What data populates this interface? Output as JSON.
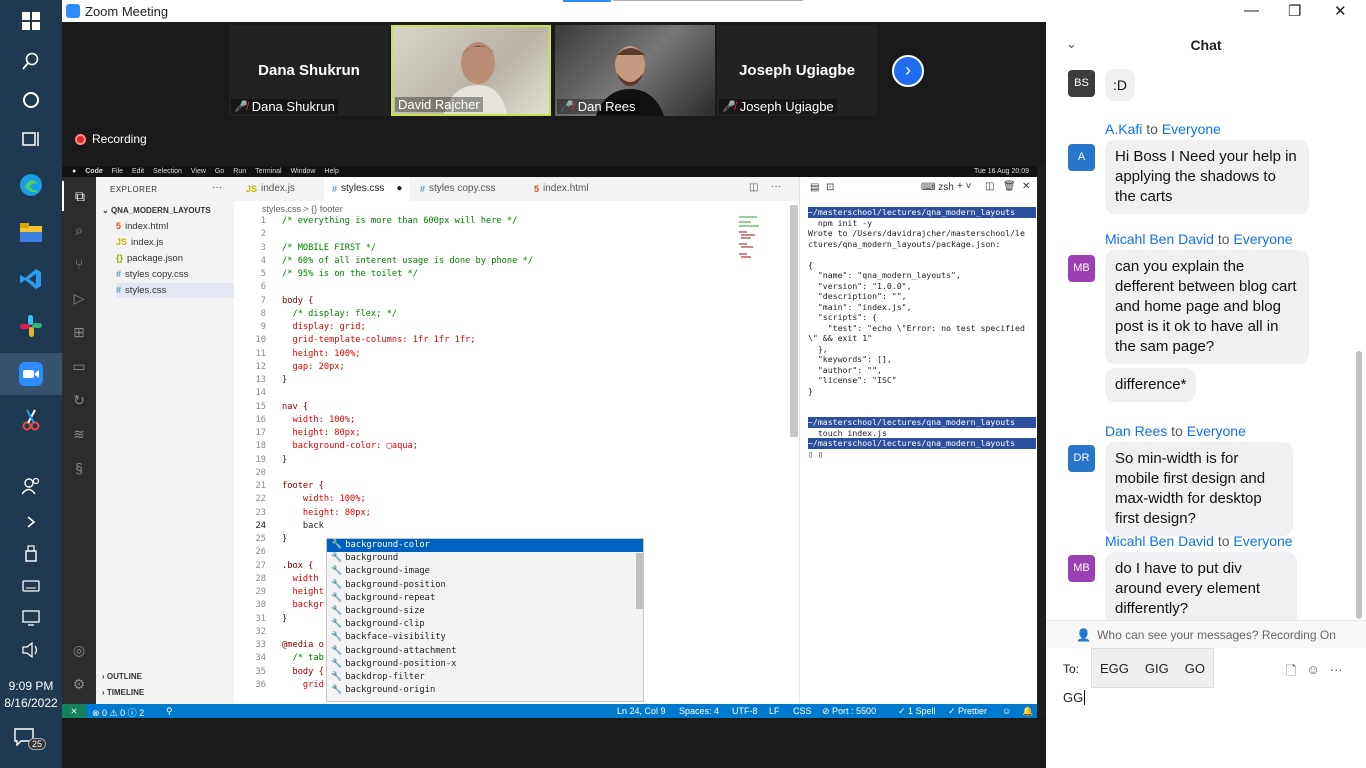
{
  "taskbar": {
    "icons": [
      "windows-icon",
      "search-icon",
      "cortana-icon",
      "task-view-icon",
      "edge-icon",
      "file-explorer-icon",
      "vscode-icon",
      "slack-icon",
      "zoom-icon",
      "snip-icon",
      "people-icon",
      "chevron-icon",
      "usb-icon",
      "keyboard-icon",
      "tablet-icon",
      "volume-icon"
    ],
    "time": "9:09 PM",
    "date": "8/16/2022",
    "notifications": "25"
  },
  "window": {
    "title": "Zoom Meeting",
    "controls": {
      "minimize": "—",
      "restore": "❐",
      "close": "✕"
    }
  },
  "gallery": {
    "participants": [
      {
        "name": "Dana Shukrun",
        "big_name": "Dana Shukrun",
        "muted": true,
        "video": false
      },
      {
        "name": "David Rajcher",
        "big_name": "",
        "muted": false,
        "video": true,
        "active": true
      },
      {
        "name": "Dan Rees",
        "big_name": "",
        "muted": true,
        "video": true
      },
      {
        "name": "Joseph Ugiagbe",
        "big_name": "Joseph Ugiagbe",
        "muted": true,
        "video": false
      }
    ],
    "next": "›",
    "recording": "Recording"
  },
  "mac_menu": {
    "items": [
      "Code",
      "File",
      "Edit",
      "Selection",
      "View",
      "Go",
      "Run",
      "Terminal",
      "Window",
      "Help"
    ],
    "clock": "Tue 16 Aug 20:09"
  },
  "vscode": {
    "explorer_title": "EXPLORER",
    "project": "QNA_MODERN_LAYOUTS",
    "files": [
      {
        "name": "index.html",
        "icon": "5",
        "color": "#e44d26"
      },
      {
        "name": "index.js",
        "icon": "JS",
        "color": "#cbb800"
      },
      {
        "name": "package.json",
        "icon": "{}",
        "color": "#8bb200"
      },
      {
        "name": "styles copy.css",
        "icon": "#",
        "color": "#519aba"
      },
      {
        "name": "styles.css",
        "icon": "#",
        "color": "#519aba",
        "selected": true
      }
    ],
    "outline": "OUTLINE",
    "timeline": "TIMELINE",
    "tabs": [
      {
        "label": "index.js",
        "icon": "JS",
        "color": "#cbb800"
      },
      {
        "label": "styles.css",
        "icon": "#",
        "color": "#519aba",
        "active": true,
        "modified": "●"
      },
      {
        "label": "styles copy.css",
        "icon": "#",
        "color": "#519aba"
      },
      {
        "label": "index.html",
        "icon": "5",
        "color": "#e44d26"
      }
    ],
    "breadcrumb": "styles.css > {} footer",
    "code_lines": [
      {
        "n": "1",
        "t": "/* everything is more than 600px will here */",
        "k": "cm"
      },
      {
        "n": "2",
        "t": "",
        "k": ""
      },
      {
        "n": "3",
        "t": "/* MOBILE FIRST */",
        "k": "cm"
      },
      {
        "n": "4",
        "t": "/* 60% of all interent usage is done by phone */",
        "k": "cm"
      },
      {
        "n": "5",
        "t": "/* 95% is on the toilet */",
        "k": "cm"
      },
      {
        "n": "6",
        "t": "",
        "k": ""
      },
      {
        "n": "7",
        "t": "body {",
        "k": "sel"
      },
      {
        "n": "8",
        "t": "  /* display: flex; */",
        "k": "cm"
      },
      {
        "n": "9",
        "t": "  display: grid;",
        "k": "pr"
      },
      {
        "n": "10",
        "t": "  grid-template-columns: 1fr 1fr 1fr;",
        "k": "pr"
      },
      {
        "n": "11",
        "t": "  height: 100%;",
        "k": "pr"
      },
      {
        "n": "12",
        "t": "  gap: 20px;",
        "k": "pr"
      },
      {
        "n": "13",
        "t": "}",
        "k": ""
      },
      {
        "n": "14",
        "t": "",
        "k": ""
      },
      {
        "n": "15",
        "t": "nav {",
        "k": "sel"
      },
      {
        "n": "16",
        "t": "  width: 100%;",
        "k": "pr"
      },
      {
        "n": "17",
        "t": "  height: 80px;",
        "k": "pr"
      },
      {
        "n": "18",
        "t": "  background-color: ▢aqua;",
        "k": "pr"
      },
      {
        "n": "19",
        "t": "}",
        "k": ""
      },
      {
        "n": "20",
        "t": "",
        "k": ""
      },
      {
        "n": "21",
        "t": "footer {",
        "k": "sel"
      },
      {
        "n": "22",
        "t": "    width: 100%;",
        "k": "pr"
      },
      {
        "n": "23",
        "t": "    height: 80px;",
        "k": "pr"
      },
      {
        "n": "24",
        "t": "    back",
        "k": "",
        "current": true
      },
      {
        "n": "25",
        "t": "}",
        "k": ""
      },
      {
        "n": "26",
        "t": "",
        "k": ""
      },
      {
        "n": "27",
        "t": ".box {",
        "k": "sel"
      },
      {
        "n": "28",
        "t": "  width",
        "k": "pr"
      },
      {
        "n": "29",
        "t": "  height",
        "k": "pr"
      },
      {
        "n": "30",
        "t": "  backgr",
        "k": "pr"
      },
      {
        "n": "31",
        "t": "}",
        "k": ""
      },
      {
        "n": "32",
        "t": "",
        "k": ""
      },
      {
        "n": "33",
        "t": "@media o",
        "k": "sel"
      },
      {
        "n": "34",
        "t": "  /* tab",
        "k": "cm"
      },
      {
        "n": "35",
        "t": "  body {",
        "k": "sel"
      },
      {
        "n": "36",
        "t": "    grid",
        "k": "pr"
      }
    ],
    "suggestions": [
      "background-color",
      "background",
      "background-image",
      "background-position",
      "background-repeat",
      "background-size",
      "background-clip",
      "backface-visibility",
      "background-attachment",
      "background-position-x",
      "backdrop-filter",
      "background-origin"
    ],
    "terminal_title": "zsh",
    "terminal_lines": [
      {
        "t": "~/masterschool/lectures/qna_modern_layouts",
        "hl": true
      },
      {
        "t": "  npm init -y",
        "hl": false
      },
      {
        "t": "Wrote to /Users/davidrajcher/masterschool/le",
        "hl": false
      },
      {
        "t": "ctures/qna_modern_layouts/package.json:",
        "hl": false
      },
      {
        "t": "",
        "hl": false
      },
      {
        "t": "{",
        "hl": false
      },
      {
        "t": "  \"name\": \"qna_modern_layouts\",",
        "hl": false
      },
      {
        "t": "  \"version\": \"1.0.0\",",
        "hl": false
      },
      {
        "t": "  \"description\": \"\",",
        "hl": false
      },
      {
        "t": "  \"main\": \"index.js\",",
        "hl": false
      },
      {
        "t": "  \"scripts\": {",
        "hl": false
      },
      {
        "t": "    \"test\": \"echo \\\"Error: no test specified",
        "hl": false
      },
      {
        "t": "\\\" && exit 1\"",
        "hl": false
      },
      {
        "t": "  },",
        "hl": false
      },
      {
        "t": "  \"keywords\": [],",
        "hl": false
      },
      {
        "t": "  \"author\": \"\",",
        "hl": false
      },
      {
        "t": "  \"license\": \"ISC\"",
        "hl": false
      },
      {
        "t": "}",
        "hl": false
      },
      {
        "t": "",
        "hl": false
      },
      {
        "t": "",
        "hl": false
      },
      {
        "t": "~/masterschool/lectures/qna_modern_layouts",
        "hl": true
      },
      {
        "t": "  touch index.js",
        "hl": false
      },
      {
        "t": "~/masterschool/lectures/qna_modern_layouts",
        "hl": true
      },
      {
        "t": "▯ ▯",
        "hl": false
      }
    ],
    "status": {
      "errors": "⊗ 0 ⚠ 0 ⓘ 2",
      "position": "Ln 24, Col 9",
      "spaces": "Spaces: 4",
      "encoding": "UTF-8",
      "eol": "LF",
      "language": "CSS",
      "port": "⊘ Port : 5500",
      "spell": "✓ 1 Spell",
      "prettier": "✓ Prettier"
    }
  },
  "chat": {
    "title": "Chat",
    "messages": [
      {
        "avatar": "BS",
        "avatar_color": "#3c3c3c",
        "sender": "",
        "to": "",
        "texts": [
          ":D"
        ]
      },
      {
        "avatar": "A",
        "avatar_color": "#2776c9",
        "sender": "A.Kafi",
        "to": "Everyone",
        "texts": [
          "Hi Boss  I Need your help in applying the shadows to the carts"
        ]
      },
      {
        "avatar": "MB",
        "avatar_color": "#9b3fb3",
        "sender": "Micahl Ben David",
        "to": "Everyone",
        "texts": [
          "can you explain the defferent between blog cart and home page and blog post is it ok to have all in the sam page?",
          "difference*"
        ]
      },
      {
        "avatar": "DR",
        "avatar_color": "#2776c9",
        "sender": "Dan Rees",
        "to": "Everyone",
        "texts": [
          "So min-width is for mobile first design and max-width for desktop first design?"
        ]
      },
      {
        "avatar": "MB",
        "avatar_color": "#9b3fb3",
        "sender": "Micahl Ben David",
        "to": "Everyone",
        "texts": [
          "do I have to put div around every element differently?"
        ]
      }
    ],
    "to_word": "to",
    "who_can_see": "Who can see your messages? Recording On",
    "to_label": "To:",
    "chips": [
      "EGG",
      "GIG",
      "GO"
    ],
    "compose_value": "GG"
  }
}
